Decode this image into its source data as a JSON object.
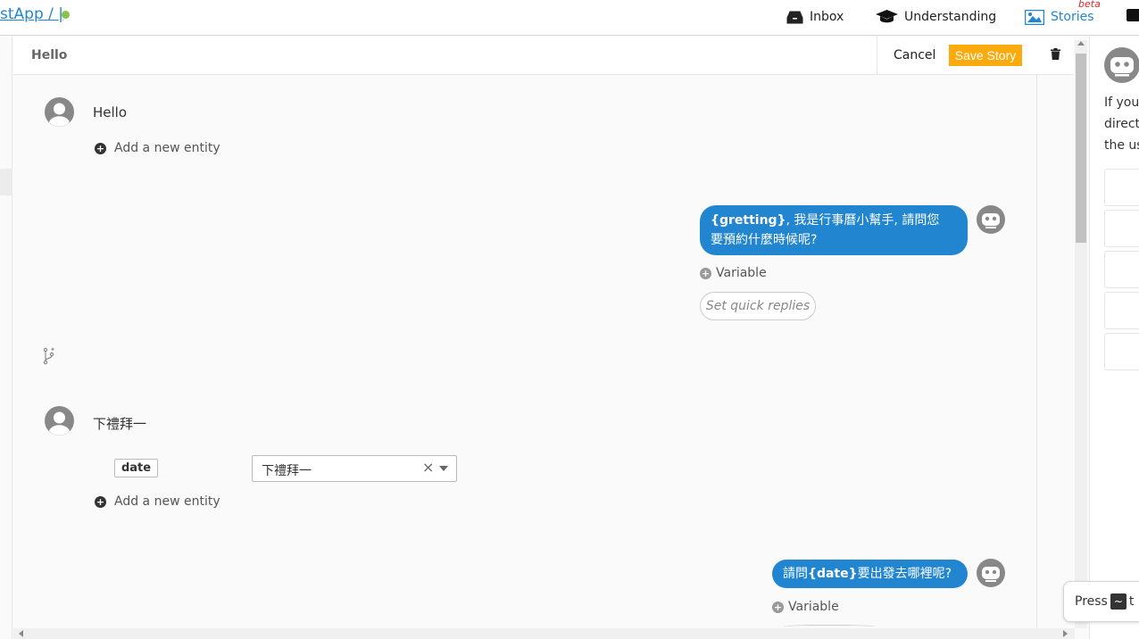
{
  "topbar": {
    "app_name": "stApp  /  |",
    "nav": {
      "inbox": "Inbox",
      "understanding": "Understanding",
      "stories": "Stories",
      "stories_badge": "beta"
    }
  },
  "story": {
    "title": "Hello",
    "cancel_label": "Cancel",
    "save_label": "Save Story"
  },
  "conversation": {
    "user_1": "Hello",
    "add_entity_1": "Add a new entity",
    "bot_1_var": "{gretting}",
    "bot_1_line1": ", 我是行事曆小幫手, 請問您",
    "bot_1_line2": "要預約什麼時候呢?",
    "variable_1": "Variable",
    "quick_replies": "Set quick replies",
    "user_2": "下禮拜一",
    "entity_name": "date",
    "entity_value": "下禮拜一",
    "entity_clear": "×",
    "add_entity_2": "Add a new entity",
    "bot_2_prefix": "請問",
    "bot_2_var": "{date}",
    "bot_2_suffix": "要出發去哪裡呢?",
    "variable_2": "Variable"
  },
  "right_panel": {
    "help_line1": "If your",
    "help_line2": "direct",
    "help_line3": "the us"
  },
  "hint": {
    "press": "Press",
    "key": "~",
    "rest": "t"
  },
  "colors": {
    "accent": "#2185d0",
    "save_button": "#fbab0d",
    "status_dot": "#8bc34a",
    "beta": "#db2828"
  }
}
